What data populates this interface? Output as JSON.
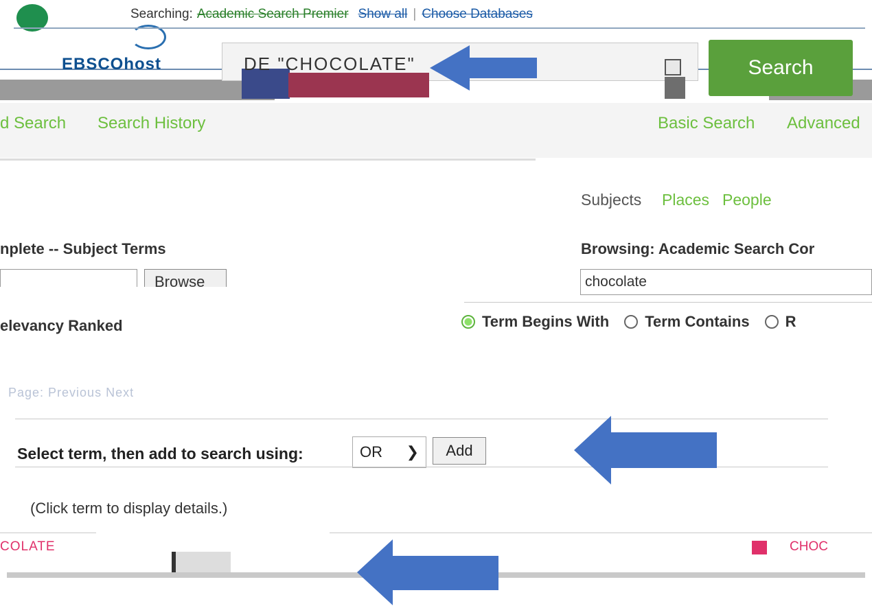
{
  "header": {
    "searching_prefix": "Searching:",
    "database": "Academic Search Premier",
    "show_all": "Show all",
    "separator": "|",
    "choose_databases": "Choose Databases",
    "ebsco_logo_text": "EBSCOhost",
    "query_value": "DE \"CHOCOLATE\"",
    "search_button": "Search"
  },
  "nav": {
    "items": [
      "d Search",
      "Search History"
    ],
    "right_items": [
      "Basic Search",
      "Advanced"
    ]
  },
  "subject_tabs": {
    "active": "Subjects",
    "links": [
      "Places",
      "People"
    ]
  },
  "left_panel": {
    "heading": "nplete -- Subject Terms",
    "browse_button": "Browse",
    "relevancy": "elevancy Ranked"
  },
  "right_panel": {
    "heading": "Browsing: Academic Search Cor",
    "browse_value": "chocolate",
    "radio_options": [
      {
        "label": "Term Begins With",
        "checked": true
      },
      {
        "label": "Term Contains",
        "checked": false
      },
      {
        "label": "R",
        "checked": false
      }
    ]
  },
  "paging_text": "Page:   Previous   Next",
  "term_action": {
    "label": "Select term, then add to search using:",
    "operator": "OR",
    "add_button": "Add"
  },
  "hint": "(Click term to display details.)",
  "results": {
    "left_term": "COLATE",
    "right_term": "CHOC"
  },
  "colors": {
    "accent_green": "#6cbf3e",
    "search_green": "#5aa03c",
    "arrow_blue": "#4472c4",
    "term_pink": "#e0306a"
  }
}
